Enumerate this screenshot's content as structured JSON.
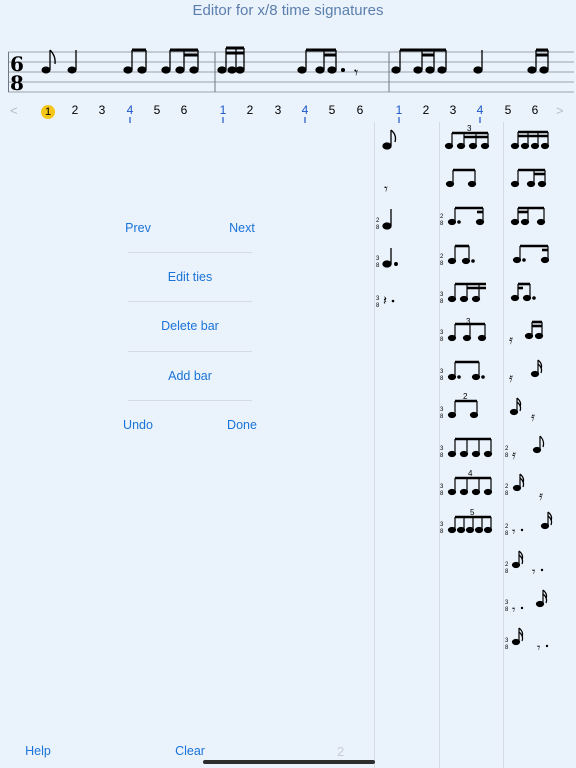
{
  "header": {
    "title": "Editor for x/8 time signatures"
  },
  "score": {
    "time_signature": {
      "numerator": "6",
      "denominator": "8"
    }
  },
  "beats": {
    "prev_arrow": "<",
    "next_arrow": ">",
    "groups": [
      [
        "1",
        "2",
        "3",
        "4",
        "5",
        "6"
      ],
      [
        "1",
        "2",
        "3",
        "4",
        "5",
        "6"
      ],
      [
        "1",
        "2",
        "3",
        "4",
        "5",
        "6"
      ]
    ],
    "current_beat": "1"
  },
  "editor": {
    "prev_label": "Prev",
    "next_label": "Next",
    "edit_ties_label": "Edit ties",
    "delete_bar_label": "Delete bar",
    "add_bar_label": "Add bar",
    "undo_label": "Undo",
    "done_label": "Done"
  },
  "footer": {
    "help_label": "Help",
    "clear_label": "Clear",
    "page_indicator": "2"
  },
  "palette": {
    "tuplet_3": "3",
    "tuplet_2": "2",
    "tuplet_4": "4",
    "tuplet_5": "5",
    "ts_numerator": "3",
    "ts_denominator": "8",
    "ts_num_two": "2"
  },
  "colors": {
    "accent": "#1a73d8",
    "current_beat": "#f5c517",
    "title": "#5b7fae",
    "background": "#eaf2fb"
  }
}
